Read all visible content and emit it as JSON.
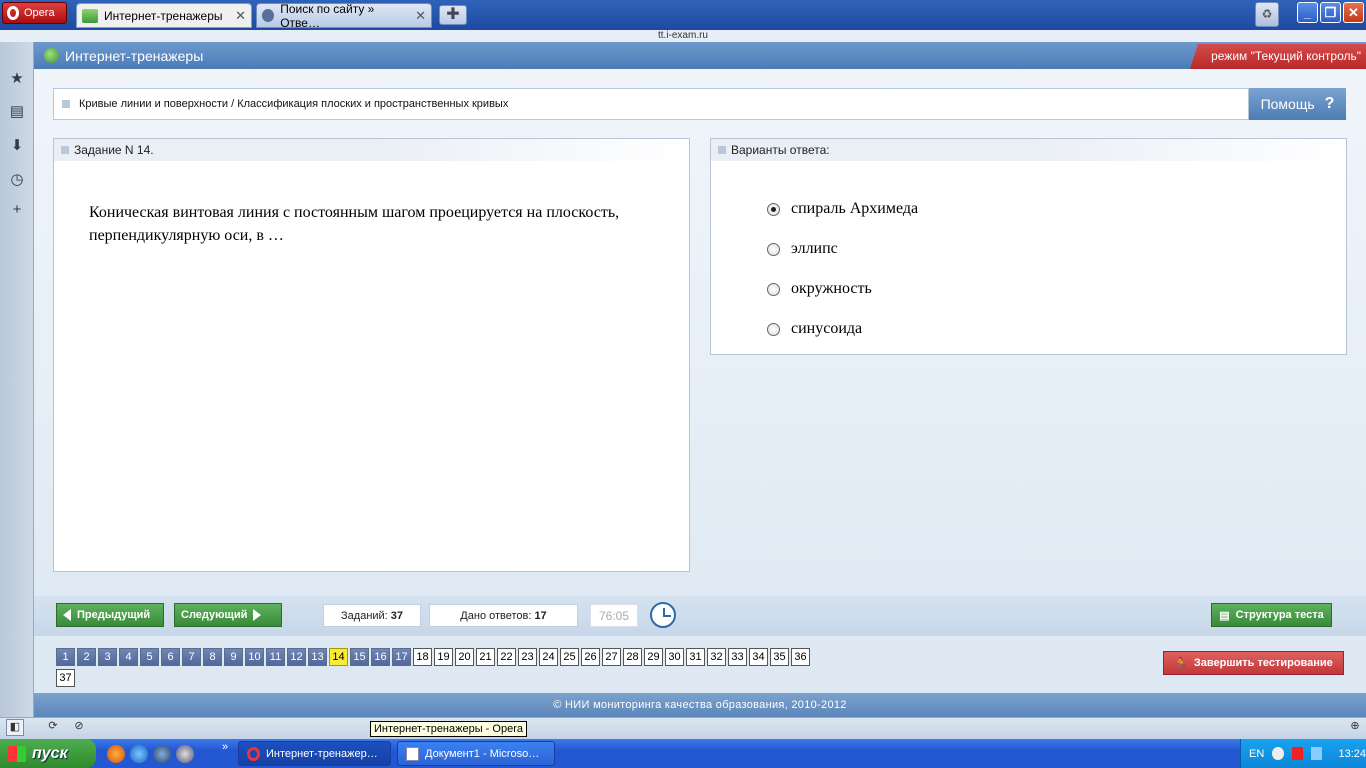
{
  "browser": {
    "opera_label": "Opera",
    "tabs": [
      {
        "title": "Интернет-тренажеры"
      },
      {
        "title": "Поиск по сайту » Отве…"
      }
    ],
    "url": "tt.i-exam.ru",
    "status_tooltip": "Интернет-тренажеры - Opera"
  },
  "app": {
    "title": "Интернет-тренажеры",
    "mode": "режим \"Текущий контроль\"",
    "breadcrumb": "Кривые линии и поверхности / Классификация плоских и пространственных кривых",
    "help_label": "Помощь",
    "help_icon": "?",
    "task_header": "Задание N 14.",
    "question": "Коническая винтовая линия с постоянным шагом проецируется на плоскость, перпендикулярную оси, в …",
    "answers_header": "Варианты ответа:",
    "options": [
      {
        "label": "спираль Архимеда",
        "selected": true
      },
      {
        "label": "эллипс",
        "selected": false
      },
      {
        "label": "окружность",
        "selected": false
      },
      {
        "label": "синусоида",
        "selected": false
      }
    ],
    "nav": {
      "prev_label": "Предыдущий",
      "next_label": "Следующий",
      "tasks_label": "Заданий:",
      "tasks_value": "37",
      "answered_label": "Дано ответов:",
      "answered_value": "17",
      "timer": "76:05",
      "structure_label": "Структура теста",
      "finish_label": "Завершить тестирование"
    },
    "questions": {
      "total": 37,
      "current": 14,
      "answered_through": 17
    },
    "footer": "© НИИ мониторинга качества образования, 2010-2012"
  },
  "taskbar": {
    "start_label": "пуск",
    "tasks": [
      {
        "label": "Интернет-тренажер…"
      },
      {
        "label": "Документ1 - Microso…"
      }
    ],
    "lang": "EN",
    "time": "13:24"
  },
  "colors": {
    "header_blue": "#4b7cb9",
    "mode_red": "#c23838",
    "nav_green": "#3a8a3a",
    "answered_blue": "#52689a",
    "current_yellow": "#f6ea3a"
  }
}
